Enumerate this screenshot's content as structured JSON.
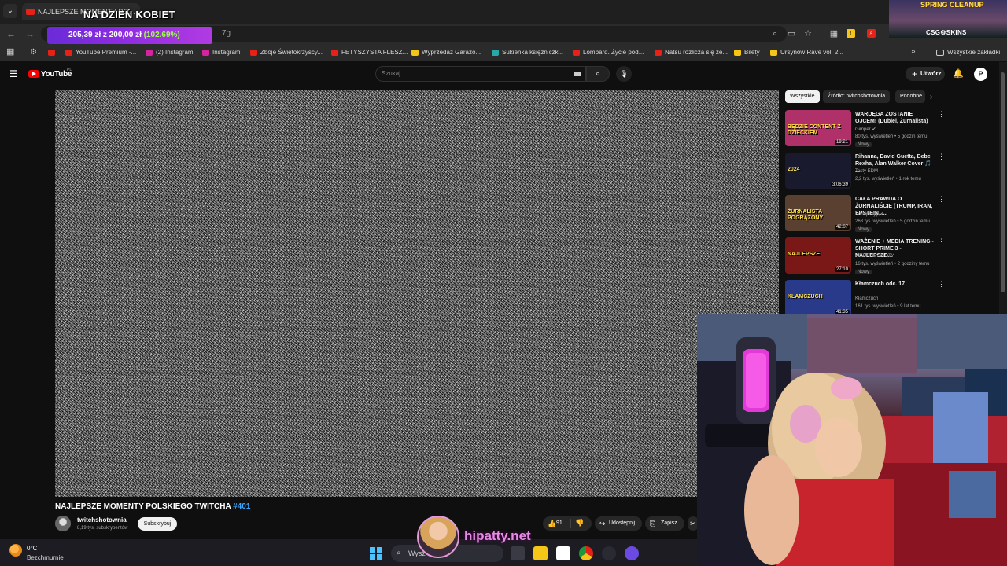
{
  "browser": {
    "tab_title": "NAJLEPSZE MOMENTY PO…",
    "overlay_title": "NA DZIEŃ KOBIET",
    "url_fragment": "7g",
    "price_badge": {
      "text": "205,39 zł z 200,00 zł",
      "percent": "(102.69%)"
    },
    "bookmarks": [
      {
        "label": "YouTube Premium -...",
        "color": "#e62117"
      },
      {
        "label": "(2) Instagram",
        "color": "#d6249f"
      },
      {
        "label": "Instagram",
        "color": "#d6249f"
      },
      {
        "label": "Zbóje Świętokrzyscy...",
        "color": "#e62117"
      },
      {
        "label": "FETYSZYSTA FLESZ...",
        "color": "#e62117"
      },
      {
        "label": "Wyprzedaż Garażo...",
        "color": "#f5c518"
      },
      {
        "label": "Sukienka księżniczk...",
        "color": "#2aa8a8"
      },
      {
        "label": "Lombard. Życie pod...",
        "color": "#e62117"
      },
      {
        "label": "Natsu rozlicza się ze...",
        "color": "#e62117"
      },
      {
        "label": "Bilety",
        "color": "#f5c518"
      },
      {
        "label": "Ursynów Rave vol. 2...",
        "color": "#f5c518"
      }
    ],
    "all_bookmarks": "Wszystkie zakładki"
  },
  "stream_overlay": {
    "spring": "SPRING CLEANUP",
    "csg": "CSG⚙SKINS"
  },
  "youtube": {
    "logo": "YouTube",
    "region": "PL",
    "search_placeholder": "Szukaj",
    "create": "Utwórz",
    "avatar_letter": "P"
  },
  "video": {
    "title": "NAJLEPSZE MOMENTY POLSKIEGO TWITCHA",
    "tag": "#401",
    "channel": "twitchshotownia",
    "subs": "8,19 tys. subskrybentów",
    "subscribe": "Subskrybuj",
    "likes": "91",
    "share": "Udostępnij",
    "save": "Zapisz"
  },
  "chips": [
    "Wszystkie",
    "Źródło: twitchshotownia",
    "Podobne"
  ],
  "recommendations": [
    {
      "title": "WARDĘGA ZOSTANIE OJCEM! (Dubiel, Żurnalista)",
      "channel": "Gimper ✔",
      "meta": "80 tys. wyświetleń • 5 godzin temu",
      "badge": "Nowy",
      "duration": "19:21",
      "thumb_text": "BĘDZIE CONTENT Z DZIECKIEM",
      "bg": "#b0306a"
    },
    {
      "title": "Rihanna, David Guetta, Bebe Rexha, Alan Walker Cover 🎵 ...",
      "channel": "Tasty EDM",
      "meta": "2,2 tys. wyświetleń • 1 rok temu",
      "badge": "",
      "duration": "3:06:39",
      "thumb_text": "2024",
      "bg": "#1a1a2e"
    },
    {
      "title": "CAŁA PRAWDA O ŻURNALIŚCIE (TRUMP, IRAN, EPSTEIN, ...",
      "channel": "Konopskyy ✔",
      "meta": "268 tys. wyświetleń • 5 godzin temu",
      "badge": "Nowy",
      "duration": "42:07",
      "thumb_text": "ŻURNALISTA POGRĄŻONY",
      "bg": "#5a4030"
    },
    {
      "title": "WAŻENIE + MEDIA TRENING - SHORT PRIME 3 - NAJLEPSZE...",
      "channel": "WYBITNE SHOTY",
      "meta": "16 tys. wyświetleń • 2 godziny temu",
      "badge": "Nowy",
      "duration": "27:10",
      "thumb_text": "NAJLEPSZE",
      "bg": "#7a1818"
    },
    {
      "title": "Kłamczuch odc. 17",
      "channel": "Kłamczuch",
      "meta": "161 tys. wyświetleń • 9 lat temu",
      "badge": "",
      "duration": "41:35",
      "thumb_text": "KŁAMCZUCH",
      "bg": "#2a3a8a"
    }
  ],
  "taskbar": {
    "temp": "0°C",
    "weather": "Bezchmurnie",
    "search": "Wysz"
  },
  "hipatty": "hipatty.net"
}
